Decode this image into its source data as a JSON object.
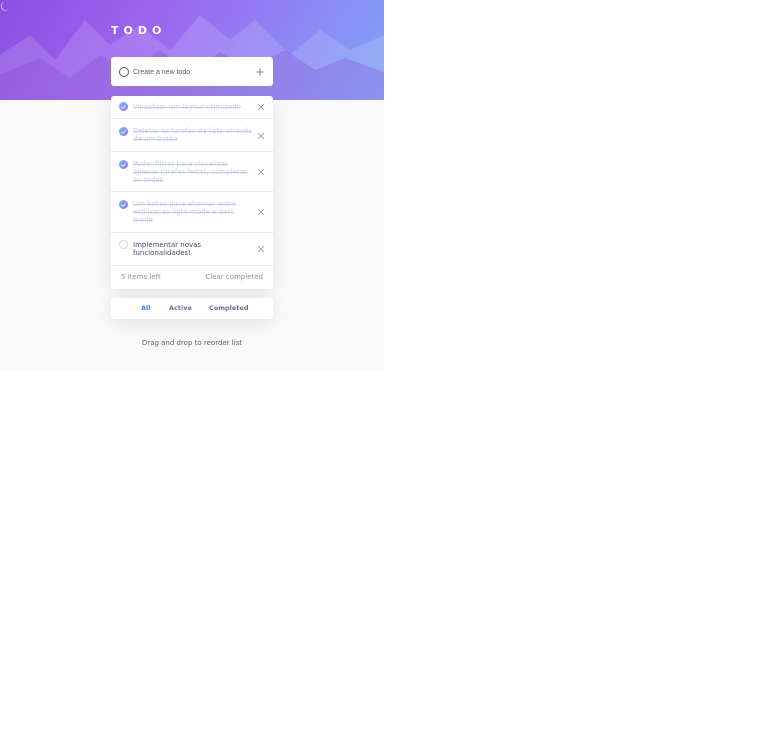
{
  "header": {
    "title": "TODO",
    "theme_icon": "moon-icon"
  },
  "new_todo": {
    "placeholder": "Create a new todo",
    "value": "",
    "add_icon": "plus-icon"
  },
  "todos": [
    {
      "text": "Visualizar um layout otimizado",
      "completed": true
    },
    {
      "text": "Deletar as tarefas da lista através de um botão",
      "completed": true
    },
    {
      "text": "Poder filtrar para visualizar apenas tarefas feitas, completas ou todas",
      "completed": true
    },
    {
      "text": "Um botao para alternar entre estilizacao light mode e dark mode",
      "completed": true
    },
    {
      "text": "Implementar novas funcionalidades!",
      "completed": false
    }
  ],
  "footer": {
    "items_left": "5 items left",
    "clear_completed": "Clear completed"
  },
  "filters": {
    "all": "All",
    "active": "Active",
    "completed": "Completed",
    "selected": "All"
  },
  "hint": "Drag and drop to reorder list",
  "colors": {
    "accent": "#3a7cfd",
    "gradient_start": "#6bc0ff",
    "gradient_end": "#9a6ff0",
    "hero_start": "#8a4fe0",
    "hero_end": "#7ea4f6"
  }
}
